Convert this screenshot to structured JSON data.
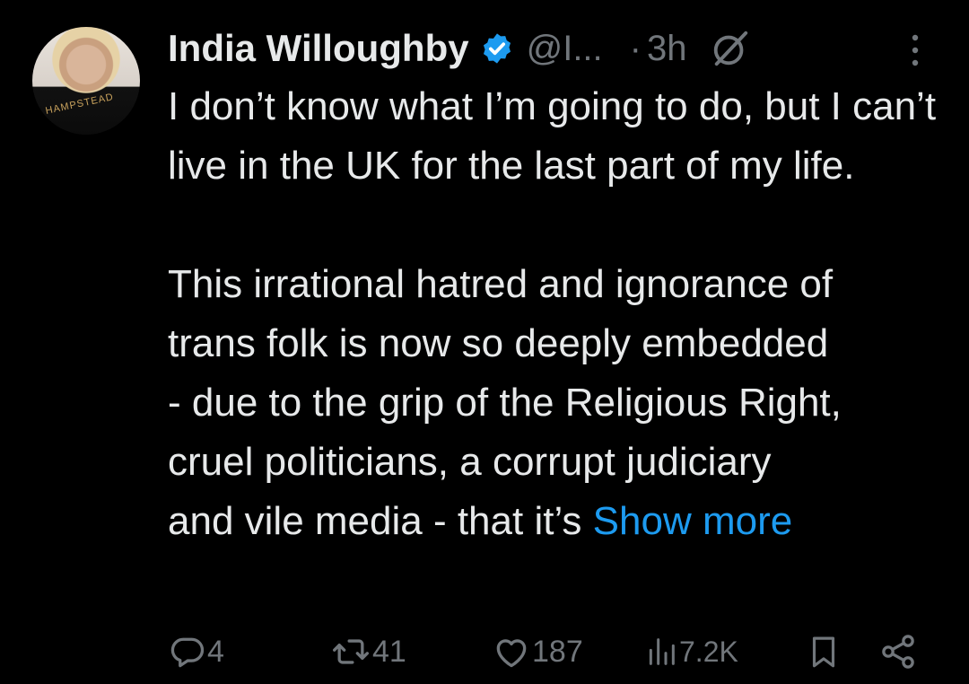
{
  "tweet": {
    "author_name": "India Willoughby",
    "handle": "@I...",
    "separator": "·",
    "time": "3h",
    "avatar_shirt_text": "HAMPSTEAD",
    "paragraph1": "I don’t know what I’m going to do, but I can’t live in the UK for the last part of my life.",
    "paragraph2_lines": [
      "This irrational hatred and ignorance of",
      "trans folk is now so deeply embedded",
      "- due to the grip of the Religious Right,",
      "cruel politicians, a corrupt judiciary",
      "and vile media - that it’s "
    ],
    "show_more": "Show more"
  },
  "actions": {
    "replies": "4",
    "reposts": "41",
    "likes": "187",
    "views": "7.2K"
  },
  "colors": {
    "background": "#000000",
    "text": "#e7e9ea",
    "muted": "#71767b",
    "link": "#1d9bf0",
    "verified": "#1d9bf0"
  },
  "icons": [
    "verified-badge-icon",
    "grok-icon",
    "more-icon",
    "reply-icon",
    "repost-icon",
    "like-icon",
    "views-icon",
    "bookmark-icon",
    "share-icon"
  ]
}
